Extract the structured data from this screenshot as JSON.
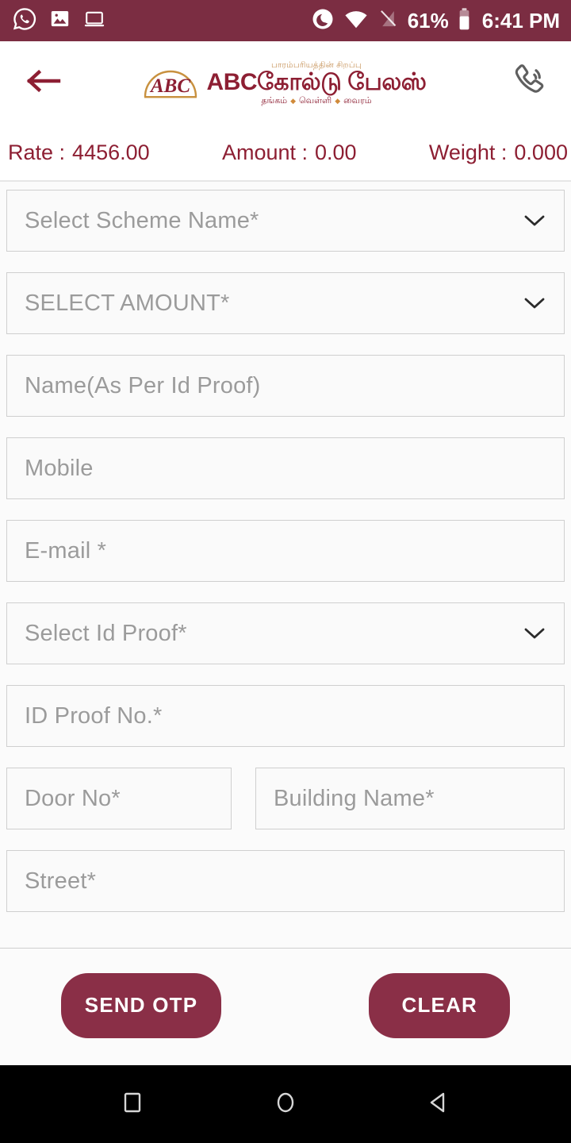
{
  "status_bar": {
    "background_color": "#7b2d42",
    "left_icons": [
      {
        "name": "whatsapp-icon"
      },
      {
        "name": "image-icon"
      },
      {
        "name": "laptop-screenshot-icon"
      }
    ],
    "right_icons": [
      {
        "name": "do-not-disturb-moon-icon"
      },
      {
        "name": "wifi-icon"
      },
      {
        "name": "no-sim-signal-icon"
      }
    ],
    "battery_percent": "61%",
    "time": "6:41 PM"
  },
  "header": {
    "back_icon": "arrow-left-icon",
    "call_icon": "phone-call-icon",
    "accent_color": "#8d1f33",
    "logo": {
      "monogram": "ABC",
      "tagline_top": "பாரம்பரியத்தின் சிறப்பு",
      "brand": "ABCகோல்டு பேலஸ்",
      "tagline_items": [
        "தங்கம்",
        "வெள்ளி",
        "வைரம்"
      ],
      "separator": "◆"
    }
  },
  "rate_bar": {
    "rate_label": "Rate :",
    "rate_value": "4456.00",
    "amount_label": "Amount :",
    "amount_value": "0.00",
    "weight_label": "Weight :",
    "weight_value": "0.000"
  },
  "form": {
    "fields": [
      {
        "name": "scheme-name-select",
        "placeholder": "Select Scheme Name*",
        "type": "select",
        "value": ""
      },
      {
        "name": "amount-select",
        "placeholder": "SELECT AMOUNT*",
        "type": "select",
        "value": ""
      },
      {
        "name": "name-input",
        "placeholder": "Name(As Per Id Proof)",
        "type": "text",
        "value": ""
      },
      {
        "name": "mobile-input",
        "placeholder": "Mobile",
        "type": "text",
        "value": ""
      },
      {
        "name": "email-input",
        "placeholder": "E-mail *",
        "type": "text",
        "value": ""
      },
      {
        "name": "id-proof-select",
        "placeholder": "Select Id Proof*",
        "type": "select",
        "value": ""
      },
      {
        "name": "id-proof-no-input",
        "placeholder": "ID Proof No.*",
        "type": "text",
        "value": ""
      }
    ],
    "address_row": [
      {
        "name": "door-no-input",
        "placeholder": "Door No*",
        "type": "text",
        "value": ""
      },
      {
        "name": "building-name-input",
        "placeholder": "Building Name*",
        "type": "text",
        "value": ""
      }
    ],
    "street": {
      "name": "street-input",
      "placeholder": "Street*",
      "type": "text",
      "value": ""
    }
  },
  "actions": {
    "send_otp_label": "SEND OTP",
    "clear_label": "CLEAR",
    "button_color": "#8a2f47"
  },
  "nav_bar": {
    "recents_icon": "square-recents-icon",
    "home_icon": "circle-home-icon",
    "back_icon": "triangle-back-icon"
  }
}
